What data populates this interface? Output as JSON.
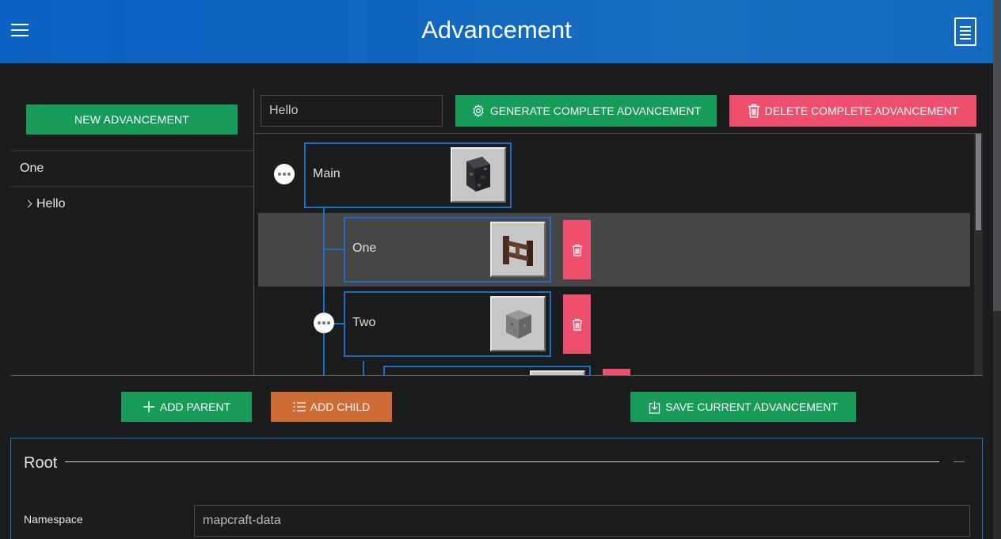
{
  "header": {
    "title": "Advancement"
  },
  "sidebar": {
    "new_button": "NEW ADVANCEMENT",
    "items": [
      {
        "label": "One"
      },
      {
        "label": "Hello"
      }
    ]
  },
  "editor": {
    "name_value": "Hello",
    "generate_label": "GENERATE COMPLETE ADVANCEMENT",
    "delete_label": "DELETE COMPLETE ADVANCEMENT"
  },
  "tree": {
    "nodes": [
      {
        "label": "Main",
        "icon": "blackstone-block-icon"
      },
      {
        "label": "One",
        "icon": "fence-gate-icon"
      },
      {
        "label": "Two",
        "icon": "stone-block-icon"
      }
    ]
  },
  "actions": {
    "add_parent": "ADD PARENT",
    "add_child": "ADD CHILD",
    "save": "SAVE CURRENT ADVANCEMENT"
  },
  "root": {
    "title": "Root",
    "namespace_label": "Namespace",
    "namespace_value": "mapcraft-data"
  },
  "colors": {
    "header": "#0b63c4",
    "primary_green": "#169b58",
    "danger_red": "#ee4f6c",
    "accent_orange": "#cf6b34",
    "tree_line_blue": "#1f6fc0"
  }
}
